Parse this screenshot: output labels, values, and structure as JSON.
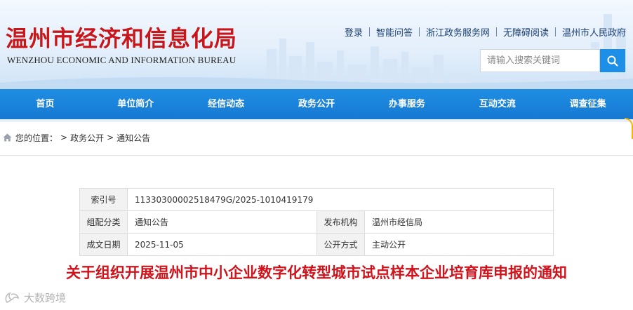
{
  "header": {
    "title_cn": "温州市经济和信息化局",
    "title_en": "WENZHOU ECONOMIC AND INFORMATION BUREAU",
    "top_links": [
      "登录",
      "智能问答",
      "浙江政务服务网",
      "无障碍阅读",
      "温州市人民政府"
    ],
    "search": {
      "placeholder": "请输入搜索关键词"
    }
  },
  "nav": {
    "items": [
      "首页",
      "单位简介",
      "经信动态",
      "政务公开",
      "办事服务",
      "互动交流",
      "调查征集"
    ]
  },
  "breadcrumb": {
    "prefix": "您的位置：",
    "items": [
      "政务公开",
      "通知公告"
    ],
    "separator": ">"
  },
  "meta": {
    "index_label": "索引号",
    "index_value": "11330300002518479G/2025-1010419179",
    "category_label": "组配分类",
    "category_value": "通知公告",
    "publisher_label": "发布机构",
    "publisher_value": "温州市经信局",
    "date_label": "成文日期",
    "date_value": "2025-11-05",
    "open_label": "公开方式",
    "open_value": "主动公开"
  },
  "article": {
    "title": "关于组织开展温州市中小企业数字化转型城市试点样本企业培育库申报的通知"
  },
  "watermark": {
    "text": "大数跨境"
  },
  "colors": {
    "brand_red": "#c8161d",
    "nav_blue": "#1678d2",
    "search_blue": "#1d8fe6",
    "title_red": "#d0121b"
  }
}
